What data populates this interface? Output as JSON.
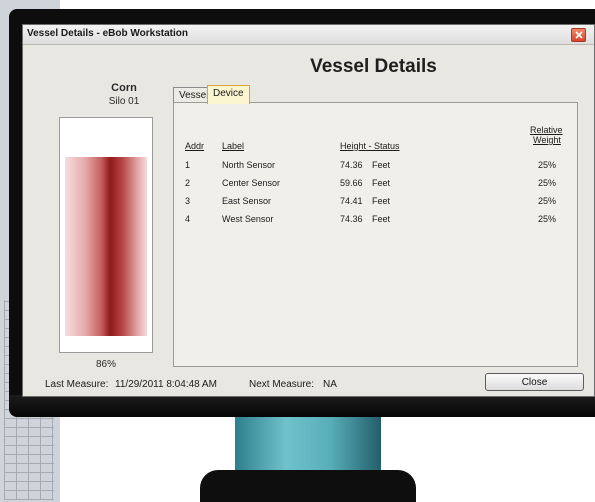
{
  "window": {
    "title": "Vessel Details - eBob Workstation",
    "heading": "Vessel Details"
  },
  "silo": {
    "product": "Corn",
    "name": "Silo 01",
    "fill_percent": "86%",
    "fill_level": 0.86,
    "fill_color": "#8e1a1a"
  },
  "tabs": [
    {
      "label": "Vessel",
      "active": false
    },
    {
      "label": "Device",
      "active": true
    }
  ],
  "table": {
    "headers": {
      "addr": "Addr",
      "label": "Label",
      "height": "Height - Status",
      "weight_line1": "Relative",
      "weight_line2": "Weight"
    },
    "rows": [
      {
        "addr": "1",
        "label": "North Sensor",
        "height": "74.36",
        "unit": "Feet",
        "weight": "25%"
      },
      {
        "addr": "2",
        "label": "Center Sensor",
        "height": "59.66",
        "unit": "Feet",
        "weight": "25%"
      },
      {
        "addr": "3",
        "label": "East Sensor",
        "height": "74.41",
        "unit": "Feet",
        "weight": "25%"
      },
      {
        "addr": "4",
        "label": "West Sensor",
        "height": "74.36",
        "unit": "Feet",
        "weight": "25%"
      }
    ]
  },
  "footer": {
    "last_measure_label": "Last Measure:",
    "last_measure_value": "11/29/2011 8:04:48 AM",
    "next_measure_label": "Next Measure:",
    "next_measure_value": "NA",
    "close_label": "Close"
  },
  "icons": {
    "close": "close-icon"
  },
  "colors": {
    "active_tab": "#fbf6d0",
    "close_button_red": "#d6452b",
    "stand_teal": "#58aeba"
  }
}
